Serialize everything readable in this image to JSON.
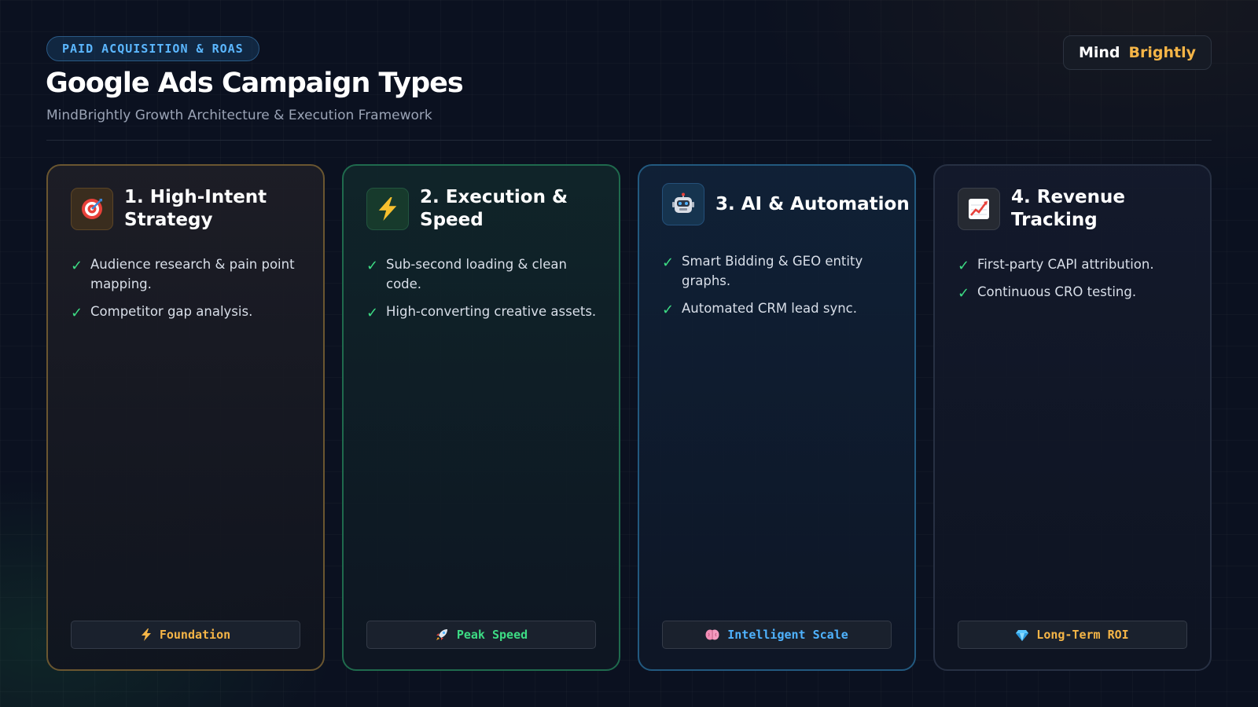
{
  "header": {
    "pill": "PAID ACQUISITION & ROAS",
    "title": "Google Ads Campaign Types",
    "subtitle": "MindBrightly Growth Architecture & Execution Framework"
  },
  "logo": {
    "word1": "Mind",
    "word2": "Brightly",
    "accent": "#f5b547"
  },
  "colors": {
    "background": "#0b1120",
    "check": "#3ddc84",
    "pill_text": "#5bb7ff"
  },
  "cards": [
    {
      "icon": "target-icon",
      "title": "1. High-Intent Strategy",
      "border": "#6a5630",
      "bullets": [
        "Audience research & pain point mapping.",
        "Competitor gap analysis."
      ],
      "footer_icon": "lightning-icon",
      "footer": "Foundation",
      "footer_color": "#f5b547"
    },
    {
      "icon": "lightning-icon",
      "title": "2. Execution & Speed",
      "border": "#1f6a4d",
      "bullets": [
        "Sub-second loading & clean code.",
        "High-converting creative assets."
      ],
      "footer_icon": "rocket-icon",
      "footer": "Peak Speed",
      "footer_color": "#3ddc84"
    },
    {
      "icon": "robot-icon",
      "title": "3. AI & Automation",
      "border": "#22597f",
      "bullets": [
        "Smart Bidding & GEO entity graphs.",
        "Automated CRM lead sync."
      ],
      "footer_icon": "brain-icon",
      "footer": "Intelligent Scale",
      "footer_color": "#4fb3ff"
    },
    {
      "icon": "chart-increasing-icon",
      "title": "4. Revenue Tracking",
      "border": "#273043",
      "bullets": [
        "First-party CAPI attribution.",
        "Continuous CRO testing."
      ],
      "footer_icon": "gem-icon",
      "footer": "Long-Term ROI",
      "footer_color": "#f5b547"
    }
  ]
}
